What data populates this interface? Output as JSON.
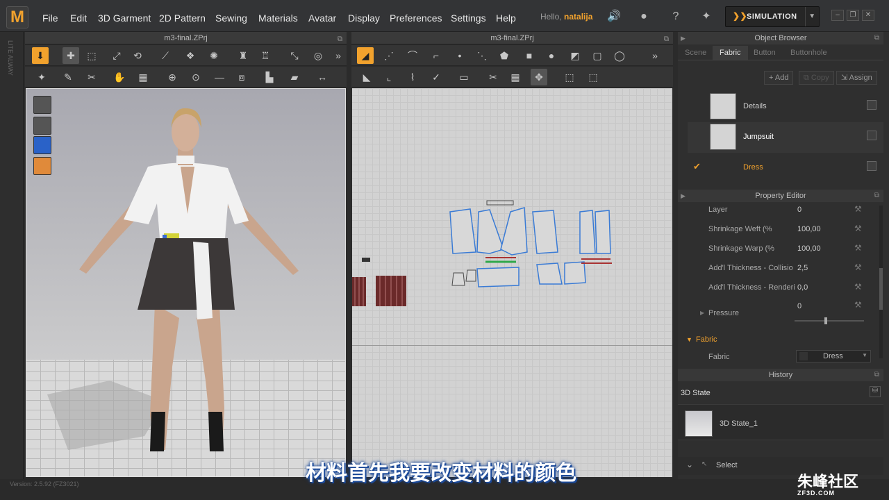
{
  "app": {
    "logo": "M",
    "title": "m3-final.ZPrj"
  },
  "menu": [
    "File",
    "Edit",
    "3D Garment",
    "2D Pattern",
    "Sewing",
    "Materials",
    "Avatar",
    "Display",
    "Preferences",
    "Settings",
    "Help"
  ],
  "user": {
    "greeting": "Hello,",
    "name": "natalija"
  },
  "simulation": {
    "label": "SIMULATION"
  },
  "left_strip": {
    "label": "LITE ALWAY"
  },
  "window3d": {
    "title": "m3-final.ZPrj"
  },
  "window2d": {
    "title": "m3-final.ZPrj"
  },
  "object_browser": {
    "title": "Object Browser",
    "tabs": [
      "Scene",
      "Fabric",
      "Button",
      "Buttonhole"
    ],
    "active_tab": "Fabric",
    "buttons": {
      "add": "Add",
      "copy": "Copy",
      "assign": "Assign"
    },
    "fabrics": [
      {
        "name": "Details",
        "selected": false
      },
      {
        "name": "Jumpsuit",
        "selected": false
      },
      {
        "name": "Dress",
        "selected": true
      }
    ]
  },
  "property_editor": {
    "title": "Property Editor",
    "props": [
      {
        "label": "Layer",
        "value": "0"
      },
      {
        "label": "Shrinkage Weft (%",
        "value": "100,00"
      },
      {
        "label": "Shrinkage Warp (%",
        "value": "100,00"
      },
      {
        "label": "Add'l Thickness - Collisio",
        "value": "2,5"
      },
      {
        "label": "Add'l Thickness - Renderi",
        "value": "0,0"
      }
    ],
    "pressure": {
      "label": "Pressure",
      "value": "0",
      "slider_fraction": 0.45
    },
    "section": "Fabric",
    "fabric_field": {
      "label": "Fabric",
      "value": "Dress"
    }
  },
  "history": {
    "title": "History",
    "state_label": "3D State",
    "items": [
      "3D State_1"
    ],
    "select_label": "Select"
  },
  "subtitle": "材料首先我要改变材料的颜色",
  "watermark": {
    "main": "朱峰社区",
    "sub": "ZF3D.COM"
  },
  "version": "Version: 2.5.92    (FZ3021)",
  "colors": {
    "accent": "#f2a22d",
    "selection_blue": "#3a7bd5"
  }
}
